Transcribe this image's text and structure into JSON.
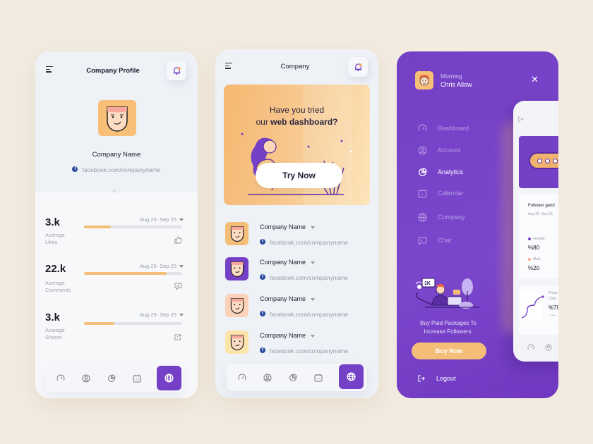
{
  "colors": {
    "background": "#f3ebe0",
    "accent_purple": "#7440c6",
    "accent_orange": "#f5be78",
    "facebook_blue": "#2b4aa0"
  },
  "profile_screen": {
    "title": "Company Profile",
    "menu_icon": "hamburger-icon",
    "notification_icon": "bell-icon",
    "company_name": "Company Name",
    "facebook_link": "facebook.com/companyname",
    "stats": [
      {
        "value": "3.k",
        "label_line1": "Averege",
        "label_line2": "Likes",
        "date_range": "Aug 25- Sep 25",
        "progress": 0.27,
        "icon": "thumbs-up-icon"
      },
      {
        "value": "22.k",
        "label_line1": "Average",
        "label_line2": "Comments",
        "date_range": "Aug 25- Sep 25",
        "progress": 0.84,
        "icon": "comment-icon"
      },
      {
        "value": "3.k",
        "label_line1": "Avarage",
        "label_line2": "Shares",
        "date_range": "Aug 25- Sep 25",
        "progress": 0.31,
        "icon": "share-icon"
      }
    ],
    "bottom_nav": [
      "dashboard-icon",
      "account-icon",
      "analytics-icon",
      "calendar-icon",
      "globe-icon"
    ],
    "bottom_nav_active": "globe-icon"
  },
  "company_screen": {
    "title": "Company",
    "banner": {
      "line1": "Have you tried",
      "line2_prefix": "our ",
      "line2_bold": "web dashboard?",
      "button_label": "Try Now"
    },
    "companies": [
      {
        "name": "Company Name",
        "link": "facebook.com/companyname",
        "avatar_color": "#f5be78"
      },
      {
        "name": "Company Name",
        "link": "facebook.com/companyname",
        "avatar_color": "#7440c6"
      },
      {
        "name": "Company Name",
        "link": "facebook.com/companyname",
        "avatar_color": "#fbd2b8"
      },
      {
        "name": "Company Name",
        "link": "facebook.com/companyname",
        "avatar_color": "#fde4a8"
      }
    ],
    "bottom_nav_active": "globe-icon"
  },
  "menu_screen": {
    "greeting": "Morning",
    "user_name": "Chris Allow",
    "close_icon": "close-icon",
    "menu_items": [
      {
        "label": "Dashboard",
        "icon": "dashboard-icon",
        "active": false
      },
      {
        "label": "Account",
        "icon": "account-icon",
        "active": false
      },
      {
        "label": "Analytics",
        "icon": "analytics-icon",
        "active": true
      },
      {
        "label": "Calendar",
        "icon": "calendar-icon",
        "active": false
      },
      {
        "label": "Company",
        "icon": "globe-icon",
        "active": false
      },
      {
        "label": "Chat",
        "icon": "chat-icon",
        "active": false
      }
    ],
    "promo_badge": "1K",
    "promo_line1": "Buy Paid Packages To",
    "promo_line2": "Increase Followers.",
    "buy_button": "Buy Now",
    "logout": "Logout",
    "preview": {
      "card_title": "Follower gend",
      "card_date": "Aug 25- Sep 25",
      "female_label": "Female",
      "female_value": "%80",
      "male_label": "Male",
      "male_value": "%20",
      "card2_line1": "Photo",
      "card2_line2": "Click",
      "card2_value": "%70",
      "card2_more": "• • •"
    }
  }
}
